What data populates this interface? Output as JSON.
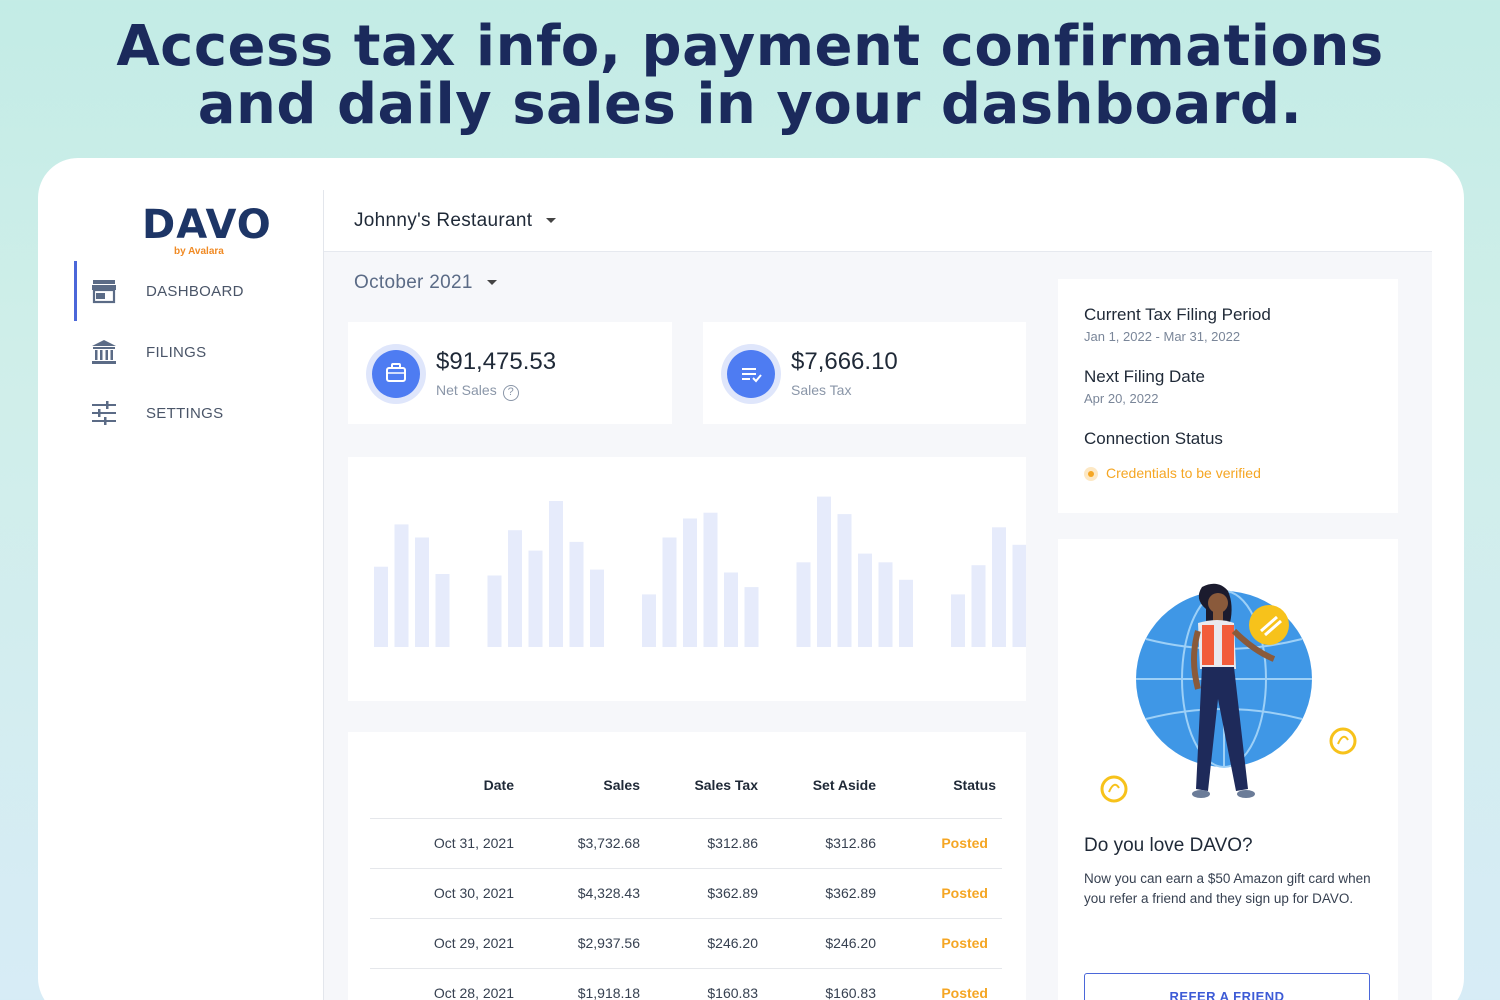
{
  "headline": {
    "line1": "Access tax info, payment confirmations",
    "line2": "and daily sales in your dashboard."
  },
  "logo": {
    "name": "DAVO",
    "sub": "by Avalara"
  },
  "sidebar": {
    "items": [
      {
        "label": "DASHBOARD",
        "icon": "store-icon",
        "active": true
      },
      {
        "label": "FILINGS",
        "icon": "bank-icon",
        "active": false
      },
      {
        "label": "SETTINGS",
        "icon": "sliders-icon",
        "active": false
      }
    ]
  },
  "header": {
    "restaurant": "Johnny's Restaurant"
  },
  "period": {
    "label": "October 2021"
  },
  "stats": {
    "net_sales": {
      "value": "$91,475.53",
      "label": "Net Sales",
      "icon": "briefcase-icon"
    },
    "sales_tax": {
      "value": "$7,666.10",
      "label": "Sales Tax",
      "icon": "list-check-icon"
    }
  },
  "chart_data": {
    "type": "bar",
    "groups": [
      [
        0.55,
        0.84,
        0.75,
        0.5
      ],
      [
        0.49,
        0.8,
        0.66,
        1.0,
        0.72,
        0.53
      ],
      [
        0.36,
        0.75,
        0.88,
        0.92,
        0.51,
        0.41
      ],
      [
        0.58,
        1.03,
        0.91,
        0.64,
        0.58,
        0.46
      ],
      [
        0.36,
        0.56,
        0.82,
        0.7
      ]
    ],
    "grid": false,
    "color": "#e6ebfb"
  },
  "table": {
    "headers": [
      "Date",
      "Sales",
      "Sales Tax",
      "Set Aside",
      "Status"
    ],
    "rows": [
      [
        "Oct 31, 2021",
        "$3,732.68",
        "$312.86",
        "$312.86",
        "Posted"
      ],
      [
        "Oct 30, 2021",
        "$4,328.43",
        "$362.89",
        "$362.89",
        "Posted"
      ],
      [
        "Oct 29, 2021",
        "$2,937.56",
        "$246.20",
        "$246.20",
        "Posted"
      ],
      [
        "Oct 28, 2021",
        "$1,918.18",
        "$160.83",
        "$160.83",
        "Posted"
      ]
    ]
  },
  "info": {
    "period_title": "Current Tax Filing Period",
    "period_value": "Jan 1, 2022 - Mar 31, 2022",
    "next_title": "Next Filing Date",
    "next_value": "Apr 20, 2022",
    "connection_title": "Connection Status",
    "connection_value": "Credentials to be verified"
  },
  "promo": {
    "title": "Do you love DAVO?",
    "text": "Now you can earn a $50 Amazon gift card when you refer a friend and they sign up for DAVO.",
    "button": "REFER A FRIEND"
  },
  "colors": {
    "accent": "#4b67d9",
    "icon_blue": "#4e7cf2",
    "status_posted": "#f5a623",
    "navy": "#1b2a5c"
  }
}
